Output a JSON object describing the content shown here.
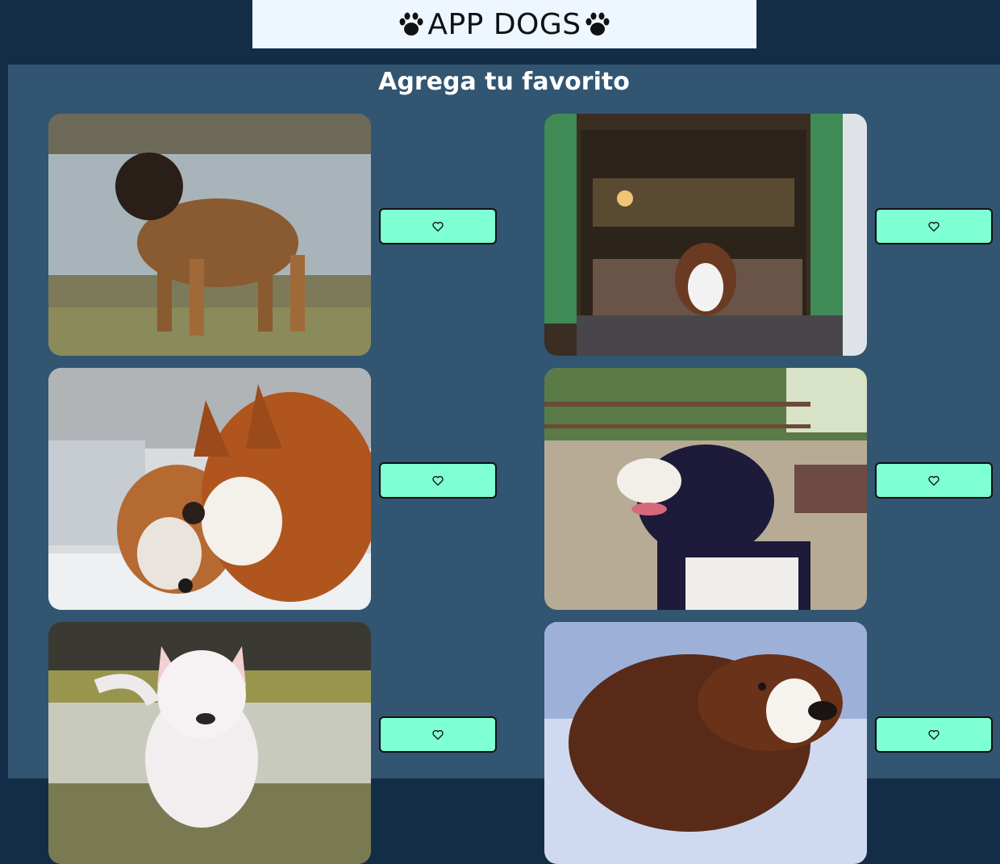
{
  "header": {
    "title": "APP DOGS",
    "left_icon": "paw-icon",
    "right_icon": "paw-icon"
  },
  "main": {
    "subtitle": "Agrega tu favorito"
  },
  "cards": [
    {
      "image": "dog-photo-leonberger-by-lake",
      "button_icon": "heart-icon"
    },
    {
      "image": "dog-photo-shepherd-at-doorway",
      "button_icon": "heart-icon"
    },
    {
      "image": "dog-photo-husky-pair-snow",
      "button_icon": "heart-icon"
    },
    {
      "image": "dog-photo-border-collie-park",
      "button_icon": "heart-icon"
    },
    {
      "image": "dog-photo-bull-terrier",
      "button_icon": "heart-icon"
    },
    {
      "image": "dog-photo-spaniel-snow",
      "button_icon": "heart-icon"
    }
  ],
  "colors": {
    "page_bg": "#142d47",
    "panel_bg": "#325571",
    "header_bg": "#eef6ff",
    "button_bg": "#7fffd4"
  }
}
